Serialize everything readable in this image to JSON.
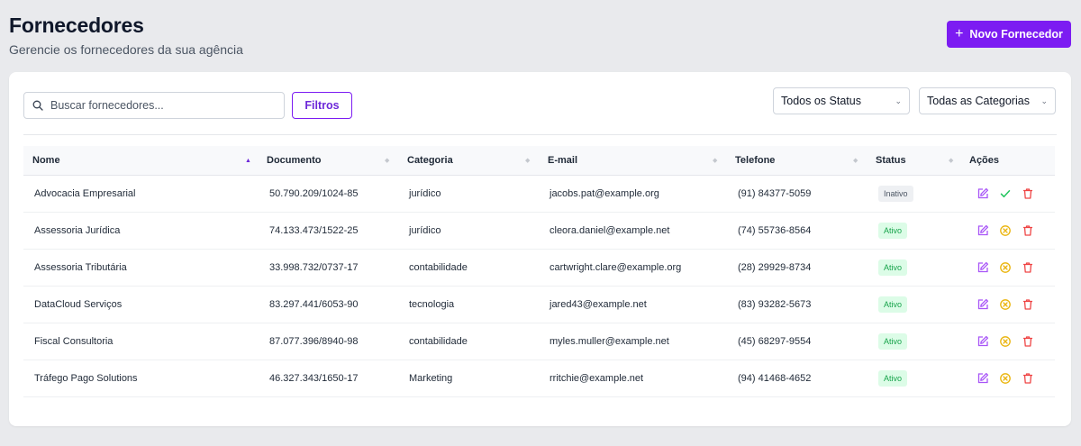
{
  "header": {
    "title": "Fornecedores",
    "subtitle": "Gerencie os fornecedores da sua agência",
    "new_button_label": "Novo Fornecedor"
  },
  "toolbar": {
    "search_placeholder": "Buscar fornecedores...",
    "search_value": "",
    "filters_label": "Filtros",
    "status_select": "Todos os Status",
    "category_select": "Todas as Categorias"
  },
  "table": {
    "columns": [
      "Nome",
      "Documento",
      "Categoria",
      "E-mail",
      "Telefone",
      "Status",
      "Ações"
    ],
    "sorted_column": "Nome",
    "rows": [
      {
        "name": "Advocacia Empresarial",
        "document": "50.790.209/1024-85",
        "category": "jurídico",
        "email": "jacobs.pat@example.org",
        "phone": "(91) 84377-5059",
        "status": "Inativo",
        "active": false
      },
      {
        "name": "Assessoria Jurídica",
        "document": "74.133.473/1522-25",
        "category": "jurídico",
        "email": "cleora.daniel@example.net",
        "phone": "(74) 55736-8564",
        "status": "Ativo",
        "active": true
      },
      {
        "name": "Assessoria Tributária",
        "document": "33.998.732/0737-17",
        "category": "contabilidade",
        "email": "cartwright.clare@example.org",
        "phone": "(28) 29929-8734",
        "status": "Ativo",
        "active": true
      },
      {
        "name": "DataCloud Serviços",
        "document": "83.297.441/6053-90",
        "category": "tecnologia",
        "email": "jared43@example.net",
        "phone": "(83) 93282-5673",
        "status": "Ativo",
        "active": true
      },
      {
        "name": "Fiscal Consultoria",
        "document": "87.077.396/8940-98",
        "category": "contabilidade",
        "email": "myles.muller@example.net",
        "phone": "(45) 68297-9554",
        "status": "Ativo",
        "active": true
      },
      {
        "name": "Tráfego Pago Solutions",
        "document": "46.327.343/1650-17",
        "category": "Marketing",
        "email": "rritchie@example.net",
        "phone": "(94) 41468-4652",
        "status": "Ativo",
        "active": true
      }
    ]
  },
  "colors": {
    "accent": "#7c1cf2",
    "edit_icon": "#a855f7",
    "activate_icon": "#22c55e",
    "deactivate_icon": "#eab308",
    "delete_icon": "#ef4444"
  },
  "icons": [
    "search-icon",
    "plus-icon",
    "chevron-down-icon",
    "sort-asc-icon",
    "sort-icon",
    "edit-icon",
    "check-icon",
    "x-circle-icon",
    "trash-icon"
  ]
}
